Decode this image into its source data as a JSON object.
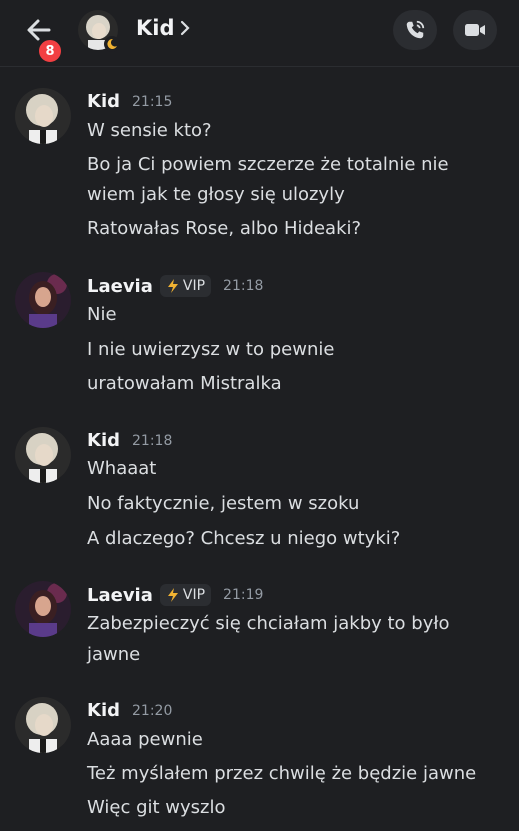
{
  "header": {
    "unread_count": "8",
    "title": "Kid",
    "colors": {
      "badge": "#f23f42",
      "moon": "#f0b232"
    }
  },
  "messages": [
    {
      "author": "Kid",
      "time": "21:15",
      "vip": "",
      "lines": [
        "W sensie kto?",
        "Bo ja Ci powiem szczerze że totalnie nie",
        "wiem jak te głosy się ulozyly",
        "Ratowałas Rose, albo Hideaki?"
      ]
    },
    {
      "author": "Laevia",
      "time": "21:18",
      "vip": "VIP",
      "lines": [
        "Nie",
        "I nie uwierzysz w to pewnie",
        "uratowałam Mistralka"
      ]
    },
    {
      "author": "Kid",
      "time": "21:18",
      "vip": "",
      "lines": [
        "Whaaat",
        "No faktycznie, jestem w szoku",
        "A dlaczego? Chcesz u niego wtyki?"
      ]
    },
    {
      "author": "Laevia",
      "time": "21:19",
      "vip": "VIP",
      "lines": [
        "Zabezpieczyć się chciałam jakby to było",
        "jawne"
      ]
    },
    {
      "author": "Kid",
      "time": "21:20",
      "vip": "",
      "lines": [
        "Aaaa pewnie",
        "Też myślałem przez chwilę że będzie jawne",
        "Więc git wyszlo"
      ]
    }
  ]
}
